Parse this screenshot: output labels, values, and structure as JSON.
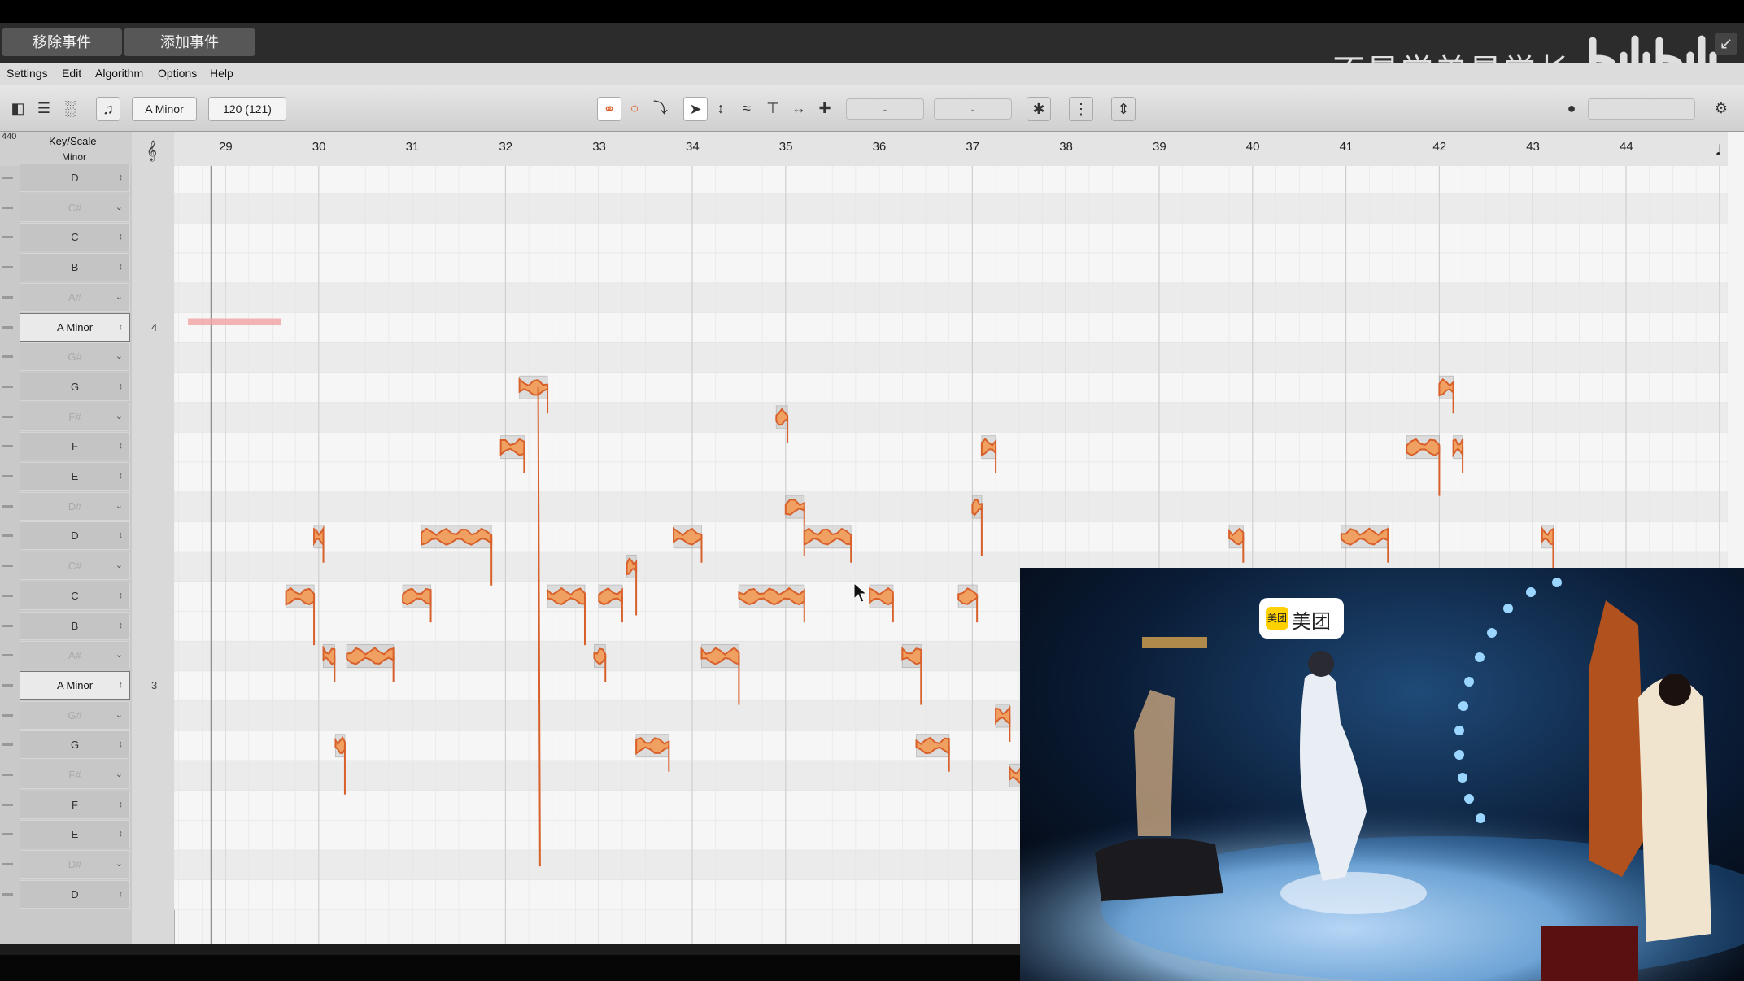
{
  "events": {
    "remove_label": "移除事件",
    "add_label": "添加事件"
  },
  "watermark": {
    "text": "不是学弟是学长"
  },
  "menu": [
    "Settings",
    "Edit",
    "Algorithm",
    "Options",
    "Help"
  ],
  "toolbar": {
    "key_label": "A Minor",
    "tempo_label": "120 (121)",
    "field1": "-",
    "field2": "-"
  },
  "scale_panel": {
    "header_label": "Key/Scale",
    "subheader": "Minor",
    "tuning": "440",
    "rows": [
      {
        "label": "D",
        "state": "normal"
      },
      {
        "label": "C#",
        "state": "dim"
      },
      {
        "label": "C",
        "state": "normal"
      },
      {
        "label": "B",
        "state": "normal"
      },
      {
        "label": "A#",
        "state": "dim"
      },
      {
        "label": "A Minor",
        "state": "sel"
      },
      {
        "label": "G#",
        "state": "dim"
      },
      {
        "label": "G",
        "state": "normal"
      },
      {
        "label": "F#",
        "state": "dim"
      },
      {
        "label": "F",
        "state": "normal"
      },
      {
        "label": "E",
        "state": "normal"
      },
      {
        "label": "D#",
        "state": "dim"
      },
      {
        "label": "D",
        "state": "normal"
      },
      {
        "label": "C#",
        "state": "dim"
      },
      {
        "label": "C",
        "state": "normal"
      },
      {
        "label": "B",
        "state": "normal"
      },
      {
        "label": "A#",
        "state": "dim"
      },
      {
        "label": "A Minor",
        "state": "sel"
      },
      {
        "label": "G#",
        "state": "dim"
      },
      {
        "label": "G",
        "state": "normal"
      },
      {
        "label": "F#",
        "state": "dim"
      },
      {
        "label": "F",
        "state": "normal"
      },
      {
        "label": "E",
        "state": "normal"
      },
      {
        "label": "D#",
        "state": "dim"
      },
      {
        "label": "D",
        "state": "normal"
      }
    ],
    "octaves": [
      {
        "label": "4",
        "row": 5
      },
      {
        "label": "3",
        "row": 17
      }
    ]
  },
  "ruler": {
    "bars": [
      "29",
      "30",
      "31",
      "32",
      "33",
      "34",
      "35",
      "36",
      "37",
      "38",
      "39",
      "40",
      "41",
      "42",
      "43",
      "44"
    ]
  },
  "notes_view": {
    "note_color": "#d8602a",
    "blobs": [
      {
        "bar": 29.65,
        "row": 14,
        "len": 0.3
      },
      {
        "bar": 29.95,
        "row": 12,
        "len": 0.1
      },
      {
        "bar": 30.05,
        "row": 16,
        "len": 0.12
      },
      {
        "bar": 30.18,
        "row": 19,
        "len": 0.1
      },
      {
        "bar": 30.3,
        "row": 16,
        "len": 0.5
      },
      {
        "bar": 30.9,
        "row": 14,
        "len": 0.3
      },
      {
        "bar": 31.1,
        "row": 12,
        "len": 0.75
      },
      {
        "bar": 31.95,
        "row": 9,
        "len": 0.25
      },
      {
        "bar": 32.15,
        "row": 7,
        "len": 0.3
      },
      {
        "bar": 32.45,
        "row": 14,
        "len": 0.4
      },
      {
        "bar": 32.95,
        "row": 16,
        "len": 0.12
      },
      {
        "bar": 33.0,
        "row": 14,
        "len": 0.25
      },
      {
        "bar": 33.3,
        "row": 13,
        "len": 0.1
      },
      {
        "bar": 33.4,
        "row": 19,
        "len": 0.35
      },
      {
        "bar": 33.8,
        "row": 12,
        "len": 0.3
      },
      {
        "bar": 34.1,
        "row": 16,
        "len": 0.4
      },
      {
        "bar": 34.5,
        "row": 14,
        "len": 0.7
      },
      {
        "bar": 34.9,
        "row": 8,
        "len": 0.12
      },
      {
        "bar": 35.0,
        "row": 11,
        "len": 0.2
      },
      {
        "bar": 35.2,
        "row": 12,
        "len": 0.5
      },
      {
        "bar": 35.9,
        "row": 14,
        "len": 0.25
      },
      {
        "bar": 36.25,
        "row": 16,
        "len": 0.2
      },
      {
        "bar": 36.4,
        "row": 19,
        "len": 0.35
      },
      {
        "bar": 36.85,
        "row": 14,
        "len": 0.2
      },
      {
        "bar": 37.0,
        "row": 11,
        "len": 0.1
      },
      {
        "bar": 37.1,
        "row": 9,
        "len": 0.15
      },
      {
        "bar": 37.25,
        "row": 18,
        "len": 0.15
      },
      {
        "bar": 37.4,
        "row": 20,
        "len": 0.15
      },
      {
        "bar": 39.75,
        "row": 12,
        "len": 0.15
      },
      {
        "bar": 40.95,
        "row": 12,
        "len": 0.5
      },
      {
        "bar": 41.65,
        "row": 9,
        "len": 0.35
      },
      {
        "bar": 42.0,
        "row": 7,
        "len": 0.15
      },
      {
        "bar": 42.15,
        "row": 9,
        "len": 0.1
      },
      {
        "bar": 43.1,
        "row": 12,
        "len": 0.12
      }
    ],
    "separation_line": {
      "row": 5.3,
      "start": 28.6,
      "end": 29.6
    }
  },
  "video": {
    "sponsor_badge": "美团",
    "sponsor_mini": "美团"
  }
}
